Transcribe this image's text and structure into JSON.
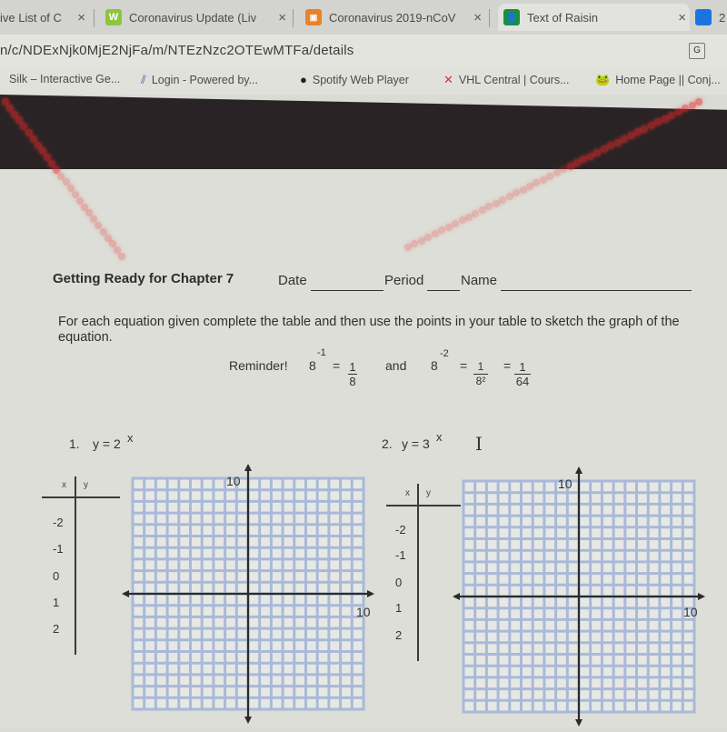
{
  "browser": {
    "tabs": [
      {
        "label": "ive List of C",
        "favicon": "",
        "fav_color": ""
      },
      {
        "label": "Coronavirus Update (Liv",
        "favicon": "W",
        "fav_color": "#8cc63f"
      },
      {
        "label": "Coronavirus 2019-nCoV",
        "favicon": "W",
        "fav_color": "#e8832a"
      },
      {
        "label": "Text of Raisin",
        "favicon": "person",
        "fav_color": "#1e8e3e"
      },
      {
        "label": "2",
        "favicon": "person",
        "fav_color": "#1a73e8"
      }
    ],
    "close_glyph": "×",
    "url": "n/c/NDExNjk0MjE2NjFa/m/NTEzNzc2OTEwMTFa/details",
    "bookmarks": [
      {
        "label": "Silk – Interactive Ge...",
        "icon": "silk-icon"
      },
      {
        "label": "Login - Powered by...",
        "icon": "login-icon"
      },
      {
        "label": "Spotify Web Player",
        "icon": "spotify-icon"
      },
      {
        "label": "VHL Central | Cours...",
        "icon": "vhl-icon"
      },
      {
        "label": "Home Page || Conj...",
        "icon": "frog-icon"
      }
    ]
  },
  "worksheet": {
    "title": "Getting Ready for Chapter 7",
    "date_label": "Date",
    "period_label": "Period",
    "name_label": "Name",
    "instructions": "For each equation given complete the table and then use the points in your table to sketch the graph of the equation.",
    "reminder": {
      "label": "Reminder!",
      "base1": "8",
      "exp1": "-1",
      "eq": "=",
      "frac1_num": "1",
      "frac1_den": "8",
      "and": "and",
      "base2": "8",
      "exp2": "-2",
      "frac2_num": "1",
      "frac2_den": "8²",
      "frac3_num": "1",
      "frac3_den": "64"
    },
    "problems": [
      {
        "number": "1.",
        "equation_base": "y = 2",
        "equation_exp": "x",
        "table_headers": [
          "x",
          "y"
        ],
        "x_values": [
          "-2",
          "-1",
          "0",
          "1",
          "2"
        ],
        "y_values": [
          "",
          "",
          "",
          "",
          ""
        ],
        "y_axis_label": "10",
        "x_axis_label": "10"
      },
      {
        "number": "2.",
        "equation_base": "y = 3",
        "equation_exp": "x",
        "table_headers": [
          "x",
          "y"
        ],
        "x_values": [
          "-2",
          "-1",
          "0",
          "1",
          "2"
        ],
        "y_values": [
          "",
          "",
          "",
          "",
          ""
        ],
        "y_axis_label": "10",
        "x_axis_label": "10"
      }
    ],
    "text_cursor": "I"
  },
  "colors": {
    "grid": "#a9b9d8",
    "axis": "#2b2b2b",
    "laser": "#e62828"
  }
}
